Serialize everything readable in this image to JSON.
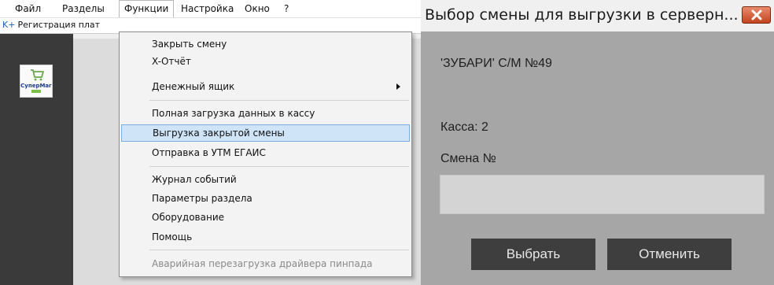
{
  "app": {
    "menu": [
      "Файл",
      "Разделы",
      "Функции",
      "Настройка",
      "Окно",
      "?"
    ],
    "tab_label": "Регистрация плат",
    "tab_prefix": "K+",
    "logo_text": "СуперМаг"
  },
  "dropdown": {
    "items": [
      "Закрыть смену",
      "X-Отчёт",
      "Денежный ящик",
      "Полная загрузка данных в кассу",
      "Выгрузка закрытой смены",
      "Отправка в УТМ ЕГАИС",
      "Журнал событий",
      "Параметры раздела",
      "Оборудование",
      "Помощь",
      "Аварийная перезагрузка драйвера пинпада"
    ],
    "highlighted_index": 4,
    "submenu_index": 2,
    "disabled_index": 10
  },
  "dialog": {
    "title": "Выбор смены для выгрузки в серверн...",
    "store": "'ЗУБАРИ' С/М №49",
    "kassa": "Касса: 2",
    "smena_label": "Смена №",
    "smena_value": "",
    "select_label": "Выбрать",
    "cancel_label": "Отменить"
  },
  "colors": {
    "dialog_bg": "#a6a6a6",
    "button_bg": "#3e3e3e",
    "highlight": "#cfe4f7",
    "close_button": "#c2441f"
  },
  "icons": {
    "close": "close-x-icon",
    "submenu": "submenu-arrow-icon",
    "logo": "cart-logo-icon"
  }
}
